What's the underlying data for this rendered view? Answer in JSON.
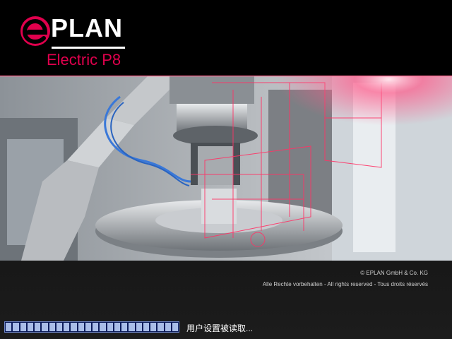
{
  "app": {
    "brand_wordmark": "PLAN",
    "product_name": "Electric P8",
    "brand_color": "#e0004d"
  },
  "footer": {
    "copyright": "© EPLAN GmbH & Co. KG",
    "rights": "Alle Rechte vorbehalten - All rights reserved - Tous droits réservés"
  },
  "progress": {
    "segments": 24,
    "fraction_filled": 1.0,
    "fill_color": "#a9bde8",
    "track_color": "#0b1b5a"
  },
  "status": {
    "text": "用户设置被读取..."
  },
  "hero": {
    "description_icon": "industrial-robot-image"
  }
}
